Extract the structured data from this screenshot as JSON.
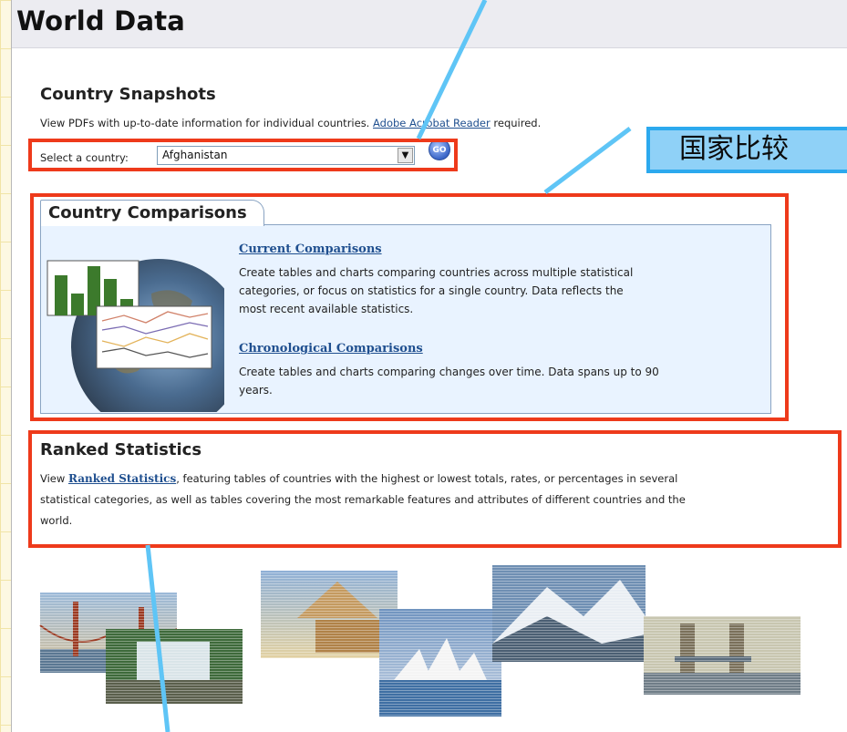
{
  "header": {
    "title": "World Data"
  },
  "snapshots": {
    "heading": "Country Snapshots",
    "description_prefix": "View PDFs with up-to-date information for individual countries.",
    "reader_link": "Adobe Acrobat Reader",
    "description_suffix": "required.",
    "select_label": "Select a country:",
    "selected_country": "Afghanistan",
    "go_label": "GO"
  },
  "comparisons": {
    "tab_title": "Country Comparisons",
    "current": {
      "link": "Current Comparisons",
      "text_1": "Create tables and charts comparing countries across multiple statistical",
      "text_2": "categories, or focus on statistics for a single country. Data reflects the",
      "text_3": "most recent available statistics."
    },
    "chronological": {
      "link": "Chronological Comparisons",
      "text_1": "Create tables and charts comparing changes over time. Data spans up to 90",
      "text_2": "years."
    }
  },
  "ranked": {
    "heading": "Ranked Statistics",
    "view_word": "View",
    "link": "Ranked Statistics",
    "line_1_rest": ", featuring tables of countries with the highest or lowest totals, rates, or percentages in several",
    "line_2": "statistical categories, as well as tables covering the most remarkable features and attributes of different countries and the",
    "line_3": "world."
  },
  "callout": {
    "text": "国家比较"
  },
  "colors": {
    "annotation_red": "#ee3a1b",
    "callout_blue": "#8fd1f7",
    "pointer_blue": "#5fc5f6",
    "link_blue": "#1f4f8f",
    "panel_blue": "#e9f3ff"
  },
  "icons": [
    "dropdown-arrow-icon",
    "go-icon",
    "globe-chart-icon",
    "landmarks-collage"
  ]
}
